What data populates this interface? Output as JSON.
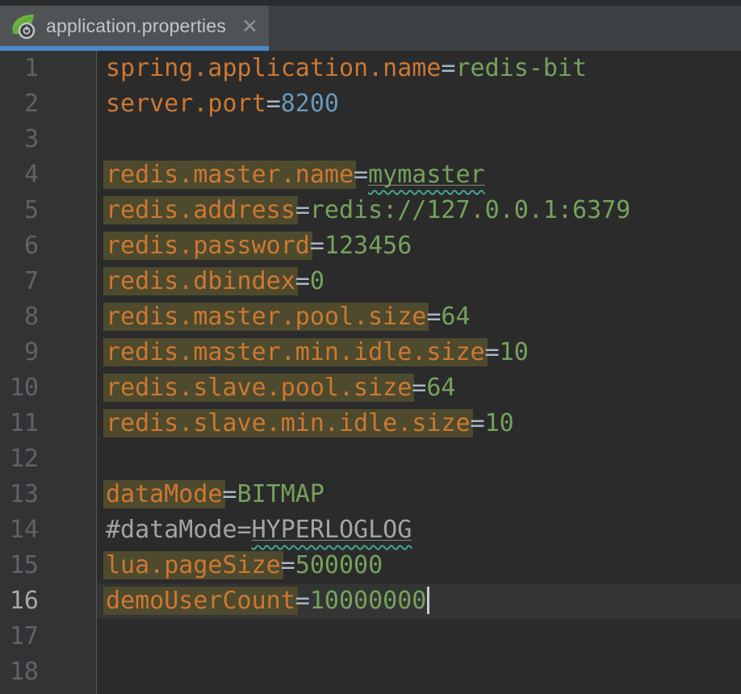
{
  "tab_bar": {
    "active_tab": {
      "title": "application.properties",
      "icon": "spring-boot-leaf-gear",
      "close_glyph": "✕"
    }
  },
  "colors": {
    "tab_underline": "#4a88c7",
    "key_orange": "#cc7832",
    "equals_gray": "#a9b7c6",
    "value_green": "#75a25c",
    "number_blue": "#6897bb",
    "comment_gray": "#a2a4a6",
    "occurrence_highlight_olive": "#4e4a2d",
    "typo_squiggle_teal": "#41a690",
    "typo_solid_underline": "#7f8d79",
    "current_line_bg": "#343434",
    "caret_color": "#cccccc"
  },
  "editor": {
    "caret_line": 16,
    "total_lines": 18,
    "lines": [
      {
        "num": 1,
        "segments": [
          {
            "text": "spring.application.name",
            "style": "key"
          },
          {
            "text": "=",
            "style": "eq"
          },
          {
            "text": "redis-bit",
            "style": "value"
          }
        ]
      },
      {
        "num": 2,
        "segments": [
          {
            "text": "server.port",
            "style": "key"
          },
          {
            "text": "=",
            "style": "eq"
          },
          {
            "text": "8200",
            "style": "number"
          }
        ]
      },
      {
        "num": 3,
        "segments": []
      },
      {
        "num": 4,
        "segments": [
          {
            "text": "redis.master.name",
            "style": "key",
            "highlighted": true
          },
          {
            "text": "=",
            "style": "eq"
          },
          {
            "text": "mymaster",
            "style": "value",
            "typo": true
          }
        ]
      },
      {
        "num": 5,
        "segments": [
          {
            "text": "redis.address",
            "style": "key",
            "highlighted": true
          },
          {
            "text": "=",
            "style": "eq"
          },
          {
            "text": "redis://127.0.0.1:6379",
            "style": "value"
          }
        ]
      },
      {
        "num": 6,
        "segments": [
          {
            "text": "redis.password",
            "style": "key",
            "highlighted": true
          },
          {
            "text": "=",
            "style": "eq"
          },
          {
            "text": "123456",
            "style": "value"
          }
        ]
      },
      {
        "num": 7,
        "segments": [
          {
            "text": "redis.dbindex",
            "style": "key",
            "highlighted": true
          },
          {
            "text": "=",
            "style": "eq"
          },
          {
            "text": "0",
            "style": "value"
          }
        ]
      },
      {
        "num": 8,
        "segments": [
          {
            "text": "redis.master.pool.size",
            "style": "key",
            "highlighted": true
          },
          {
            "text": "=",
            "style": "eq"
          },
          {
            "text": "64",
            "style": "value"
          }
        ]
      },
      {
        "num": 9,
        "segments": [
          {
            "text": "redis.master.min.idle.size",
            "style": "key",
            "highlighted": true
          },
          {
            "text": "=",
            "style": "eq"
          },
          {
            "text": "10",
            "style": "value"
          }
        ]
      },
      {
        "num": 10,
        "segments": [
          {
            "text": "redis.slave.pool.size",
            "style": "key",
            "highlighted": true
          },
          {
            "text": "=",
            "style": "eq"
          },
          {
            "text": "64",
            "style": "value"
          }
        ]
      },
      {
        "num": 11,
        "segments": [
          {
            "text": "redis.slave.min.idle.size",
            "style": "key",
            "highlighted": true
          },
          {
            "text": "=",
            "style": "eq"
          },
          {
            "text": "10",
            "style": "value"
          }
        ]
      },
      {
        "num": 12,
        "segments": []
      },
      {
        "num": 13,
        "segments": [
          {
            "text": "dataMode",
            "style": "key",
            "highlighted": true
          },
          {
            "text": "=",
            "style": "eq"
          },
          {
            "text": "BITMAP",
            "style": "value"
          }
        ]
      },
      {
        "num": 14,
        "segments": [
          {
            "text": "#dataMode=",
            "style": "comment"
          },
          {
            "text": "HYPERLOGLOG",
            "style": "comment",
            "typo": true
          }
        ]
      },
      {
        "num": 15,
        "segments": [
          {
            "text": "lua.pageSize",
            "style": "key",
            "highlighted": true
          },
          {
            "text": "=",
            "style": "eq"
          },
          {
            "text": "500000",
            "style": "value"
          }
        ]
      },
      {
        "num": 16,
        "segments": [
          {
            "text": "demoUserCount",
            "style": "key",
            "highlighted": true
          },
          {
            "text": "=",
            "style": "eq"
          },
          {
            "text": "10000000",
            "style": "value"
          }
        ],
        "caret": true,
        "current": true
      },
      {
        "num": 17,
        "segments": []
      },
      {
        "num": 18,
        "segments": []
      }
    ]
  }
}
